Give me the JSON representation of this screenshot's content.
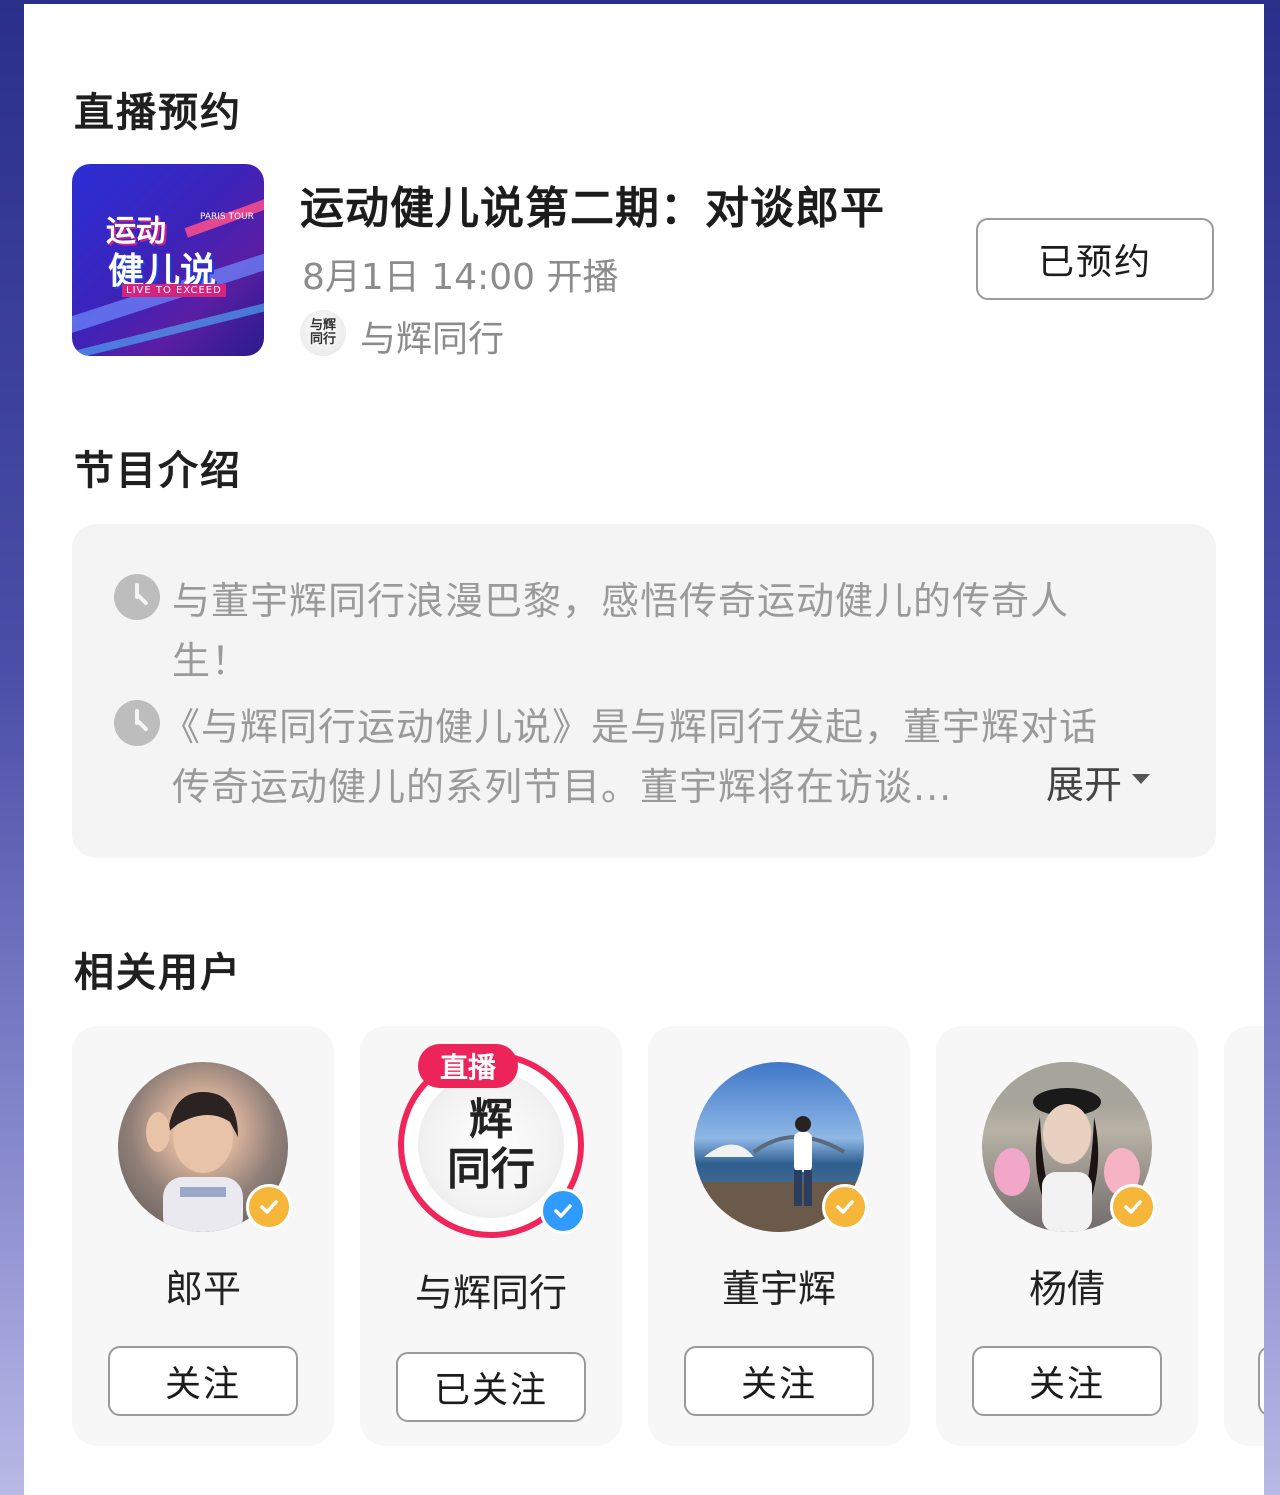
{
  "reservation": {
    "section_title": "直播预约",
    "event_title": "运动健儿说第二期：对谈郎平",
    "time": "8月1日 14:00 开播",
    "host_name": "与辉同行",
    "reserve_button": "已预约",
    "cover": {
      "line1": "运动",
      "line2": "健儿说",
      "tagline": "LIVE TO EXCEED",
      "corner": "PARIS TOUR"
    }
  },
  "intro": {
    "section_title": "节目介绍",
    "p1_line1": "与董宇辉同行浪漫巴黎，感悟传奇运动健儿的传奇人",
    "p1_line2": "生！",
    "p2_line1": "《与辉同行运动健儿说》是与辉同行发起，董宇辉对话",
    "p2_line2": "传奇运动健儿的系列节目。董宇辉将在访谈...",
    "expand_label": "展开"
  },
  "related": {
    "section_title": "相关用户",
    "live_tag": "直播",
    "users": [
      {
        "name": "郎平",
        "button": "关注",
        "badge": "gold"
      },
      {
        "name": "与辉同行",
        "button": "已关注",
        "badge": "blue"
      },
      {
        "name": "董宇辉",
        "button": "关注",
        "badge": "gold"
      },
      {
        "name": "杨倩",
        "button": "关注",
        "badge": "gold"
      }
    ]
  },
  "colors": {
    "live_red": "#ec2459",
    "verified_gold": "#f5b63a",
    "verified_blue": "#2f9bff"
  }
}
